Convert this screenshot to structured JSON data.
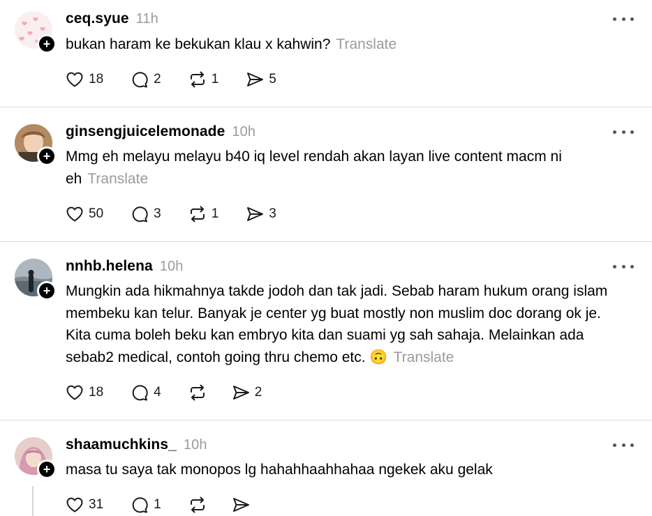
{
  "posts": [
    {
      "username": "ceq.syue",
      "time": "11h",
      "text": "bukan haram ke bekukan klau x kahwin?",
      "translate": "Translate",
      "likes": "18",
      "replies": "2",
      "reposts": "1",
      "shares": "5"
    },
    {
      "username": "ginsengjuicelemonade",
      "time": "10h",
      "text": "Mmg eh melayu melayu b40 iq level rendah akan layan live content macm ni eh",
      "translate": "Translate",
      "likes": "50",
      "replies": "3",
      "reposts": "1",
      "shares": "3"
    },
    {
      "username": "nnhb.helena",
      "time": "10h",
      "text": "Mungkin ada hikmahnya takde jodoh dan tak jadi. Sebab haram hukum orang islam membeku kan telur. Banyak je center yg buat mostly non muslim doc dorang ok je. Kita cuma boleh beku kan embryo kita dan suami yg sah sahaja. Melainkan ada sebab2 medical, contoh going thru chemo etc. 🙃",
      "translate": "Translate",
      "likes": "18",
      "replies": "4",
      "reposts": "",
      "shares": "2"
    },
    {
      "username": "shaamuchkins_",
      "time": "10h",
      "text": "masa tu saya tak monopos lg hahahhaahhahaa ngekek aku gelak",
      "translate": "",
      "likes": "31",
      "replies": "1",
      "reposts": "",
      "shares": ""
    }
  ],
  "icons": {
    "like": "heart-icon",
    "reply": "comment-icon",
    "repost": "repost-icon",
    "share": "send-icon",
    "more": "more-options-icon",
    "follow": "follow-plus-icon"
  }
}
